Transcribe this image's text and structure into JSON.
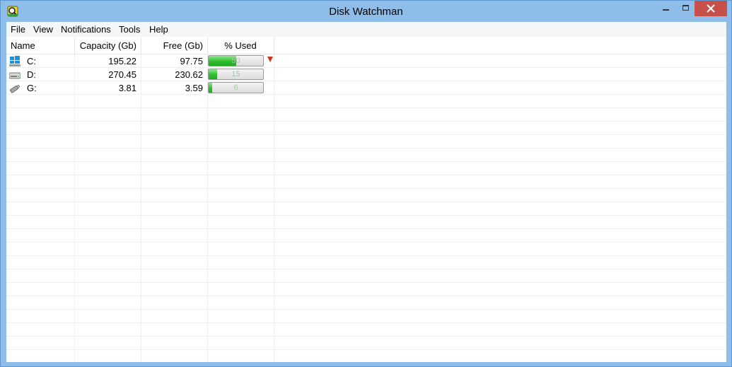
{
  "window": {
    "title": "Disk Watchman"
  },
  "menu": [
    "File",
    "View",
    "Notifications",
    "Tools",
    "Help"
  ],
  "columns": [
    "Name",
    "Capacity (Gb)",
    "Free (Gb)",
    "% Used"
  ],
  "drives": [
    {
      "name": "C:",
      "icon": "windows-drive-icon",
      "capacity": "195.22",
      "free": "97.75",
      "used_pct": 50,
      "used_label": "50",
      "alert": true
    },
    {
      "name": "D:",
      "icon": "hard-drive-icon",
      "capacity": "270.45",
      "free": "230.62",
      "used_pct": 15,
      "used_label": "15",
      "alert": false
    },
    {
      "name": "G:",
      "icon": "usb-drive-icon",
      "capacity": "3.81",
      "free": "3.59",
      "used_pct": 6,
      "used_label": "6",
      "alert": false
    }
  ],
  "colors": {
    "titlebar": "#8ebde9",
    "close_button": "#c7504b",
    "bar_fill": "#2fbf2f",
    "alert": "#c8391d"
  }
}
